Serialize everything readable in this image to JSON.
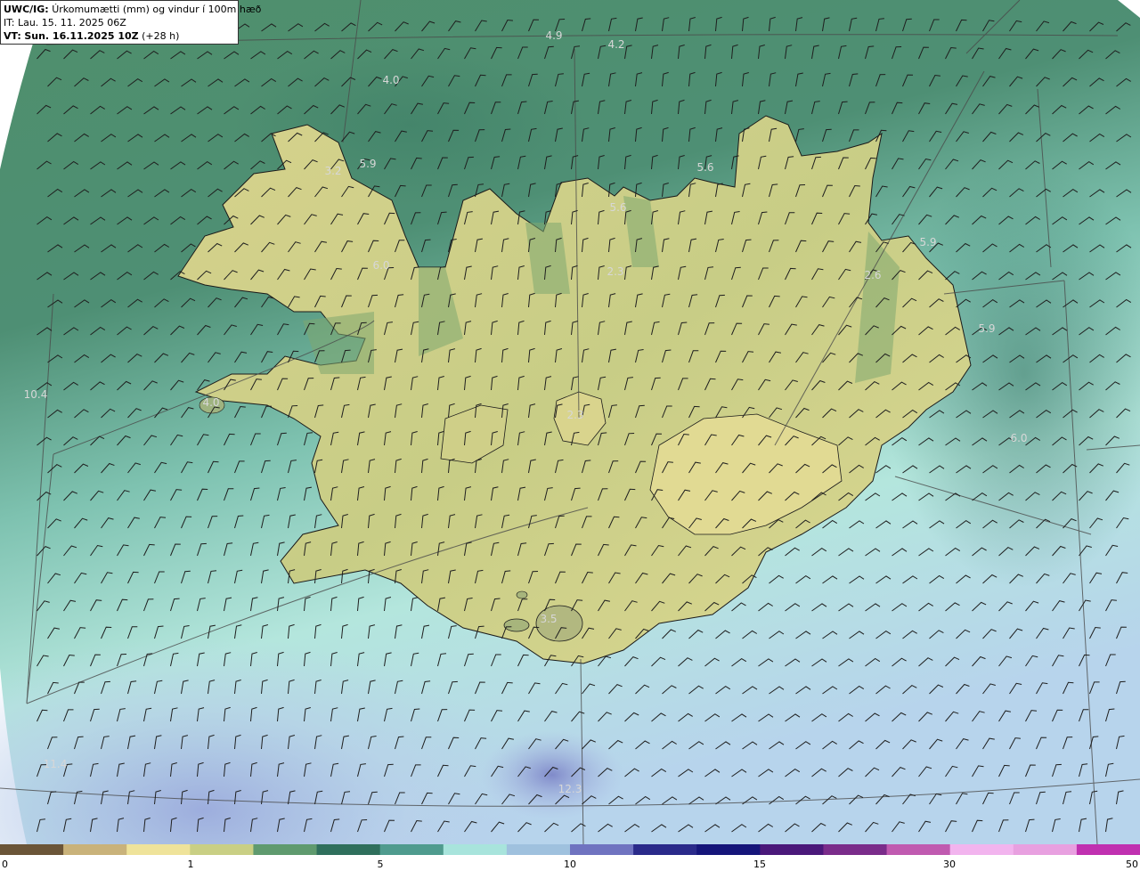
{
  "header": {
    "product": "UWC/IG:",
    "title": "Úrkomumætti (mm) og vindur í 100m hæð",
    "it_label": "IT:",
    "it_value": "Lau. 15. 11. 2025 06Z",
    "vt_label": "VT:",
    "vt_value": "Sun. 16.11.2025 10Z",
    "vt_offset": "(+28 h)"
  },
  "colorbar": {
    "ticks": [
      "0",
      "1",
      "5",
      "10",
      "15",
      "30",
      "50"
    ],
    "colors": [
      "#6b5538",
      "#c9b27a",
      "#efe39a",
      "#c9cf84",
      "#5f9a6e",
      "#2f6f5c",
      "#4f9b8e",
      "#a8e4dc",
      "#9fc1de",
      "#6f73c0",
      "#2a2a8a",
      "#15157a",
      "#4a187a",
      "#7a2c8a",
      "#c05ab0",
      "#f2b4ee",
      "#e8a0e0",
      "#c030b0"
    ]
  },
  "map_labels": [
    {
      "text": "4.9",
      "color": "#d7d7d7"
    },
    {
      "text": "4.2",
      "color": "#d7d7d7"
    },
    {
      "text": "4.0",
      "color": "#d7d7d7"
    },
    {
      "text": "5.9",
      "color": "#d7d7d7"
    },
    {
      "text": "3.2",
      "color": "#d7d7d7"
    },
    {
      "text": "5.6",
      "color": "#d7d7d7"
    },
    {
      "text": "5.6",
      "color": "#d7d7d7"
    },
    {
      "text": "6.0",
      "color": "#d7d7d7"
    },
    {
      "text": "2.3",
      "color": "#d7d7d7"
    },
    {
      "text": "5.9",
      "color": "#d7d7d7"
    },
    {
      "text": "2.6",
      "color": "#d7d7d7"
    },
    {
      "text": "5.9",
      "color": "#d7d7d7"
    },
    {
      "text": "10.4",
      "color": "#d7d7d7"
    },
    {
      "text": "4.0",
      "color": "#d7d7d7"
    },
    {
      "text": "2.3",
      "color": "#d7d7d7"
    },
    {
      "text": "6.0",
      "color": "#d7d7d7"
    },
    {
      "text": "3.5",
      "color": "#d7d7d7"
    },
    {
      "text": "11.4",
      "color": "#d7d7d7"
    },
    {
      "text": "12.3",
      "color": "#d7d7d7"
    }
  ]
}
